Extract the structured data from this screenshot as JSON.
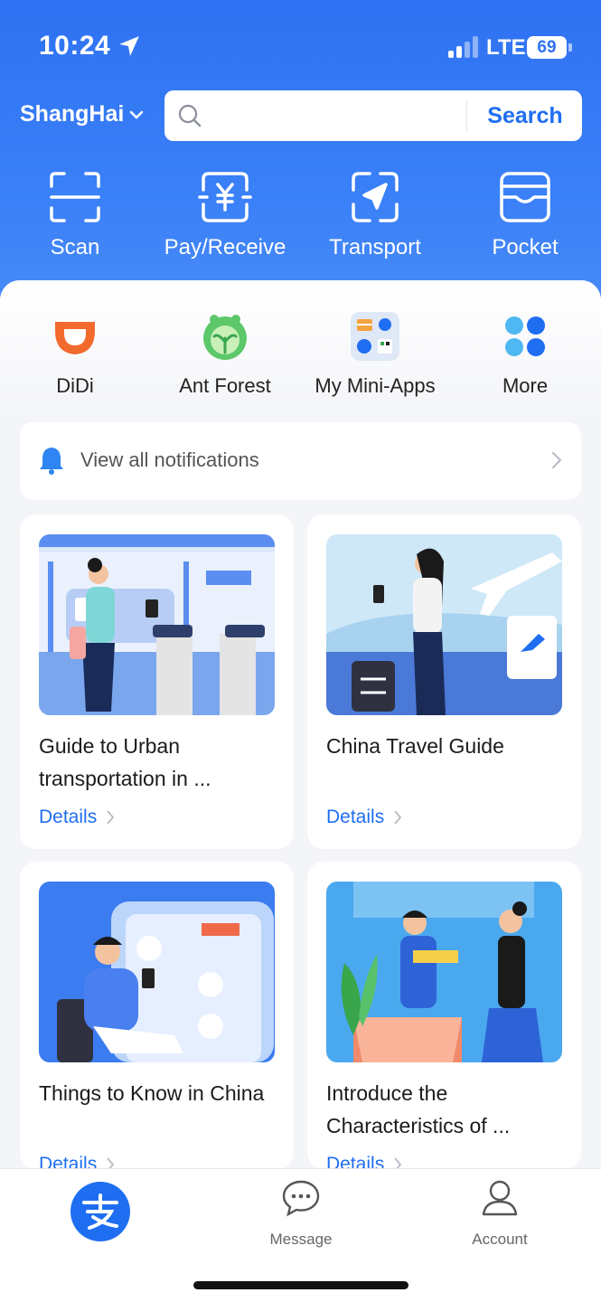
{
  "status_bar": {
    "time": "10:24",
    "network": "LTE",
    "battery": "69"
  },
  "header": {
    "city": "ShangHai",
    "search_button": "Search"
  },
  "top_actions": [
    {
      "label": "Scan",
      "icon": "scan-icon"
    },
    {
      "label": "Pay/Receive",
      "icon": "pay-receive-icon"
    },
    {
      "label": "Transport",
      "icon": "transport-icon"
    },
    {
      "label": "Pocket",
      "icon": "pocket-icon"
    }
  ],
  "apps": [
    {
      "label": "DiDi",
      "icon": "didi-icon"
    },
    {
      "label": "Ant Forest",
      "icon": "ant-forest-icon"
    },
    {
      "label": "My Mini-Apps",
      "icon": "mini-apps-icon"
    },
    {
      "label": "More",
      "icon": "more-icon"
    }
  ],
  "notifications": {
    "label": "View all notifications"
  },
  "cards": [
    {
      "title": "Guide to Urban transportation in ...",
      "details": "Details"
    },
    {
      "title": "China Travel Guide",
      "details": "Details"
    },
    {
      "title": "Things to Know in China",
      "details": "Details"
    },
    {
      "title": "Introduce the Characteristics of ...",
      "details": "Details"
    }
  ],
  "bottom_nav": {
    "message": "Message",
    "account": "Account"
  },
  "colors": {
    "accent": "#1f6ef2",
    "header_bg": "#3a80f7"
  }
}
